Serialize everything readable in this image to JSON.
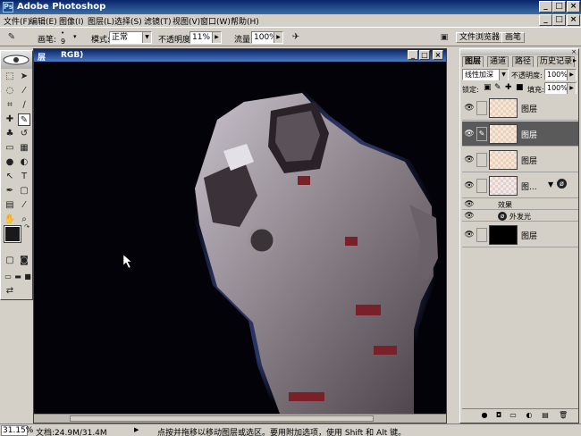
{
  "app": {
    "title": "Adobe Photoshop"
  },
  "window_buttons": {
    "minimize": "_",
    "maximize": "□",
    "close": "×"
  },
  "menu": [
    "文件(F)",
    "编辑(E)",
    "图像(I)",
    "图层(L)",
    "选择(S)",
    "滤镜(T)",
    "视图(V)",
    "窗口(W)",
    "帮助(H)"
  ],
  "options": {
    "brush_label": "画笔:",
    "brush_size": "9",
    "mode_label": "模式:",
    "mode_value": "正常",
    "opacity_label": "不透明度:",
    "opacity_value": "11%",
    "flow_label": "流量:",
    "flow_value": "100%"
  },
  "palette_well": {
    "file_browser": "文件浏览器",
    "brushes": "画笔"
  },
  "document": {
    "title_left": "层",
    "title_mode": "RGB)"
  },
  "status": {
    "zoom": "31.15%",
    "doc_size": "文档:24.9M/31.4M",
    "hint": "点按并拖移以移动图层或选区。要用附加选项，使用 Shift 和 Alt 键。"
  },
  "layers_panel": {
    "tabs": [
      "图层",
      "通道",
      "路径",
      "历史记录"
    ],
    "blend_mode": "线性加深",
    "opacity_label": "不透明度:",
    "opacity_value": "100%",
    "lock_label": "锁定:",
    "fill_label": "填充:",
    "fill_value": "100%",
    "layers": [
      {
        "name": "图层",
        "selected": false
      },
      {
        "name": "图层",
        "selected": true
      },
      {
        "name": "图层",
        "selected": false
      },
      {
        "name": "图...",
        "selected": false
      }
    ],
    "effects_label": "效果",
    "outer_glow": "外发光",
    "bottom_layer": "图层",
    "fx_symbol": "ø"
  },
  "colors": {
    "accent": "#0a246a",
    "selected_layer": "#5a5a5a",
    "canvas": "#020208"
  },
  "icons": [
    "brush-icon",
    "move-icon",
    "marquee-icon",
    "lasso-icon",
    "wand-icon",
    "crop-icon",
    "eye-icon",
    "link-icon",
    "trash-icon"
  ]
}
